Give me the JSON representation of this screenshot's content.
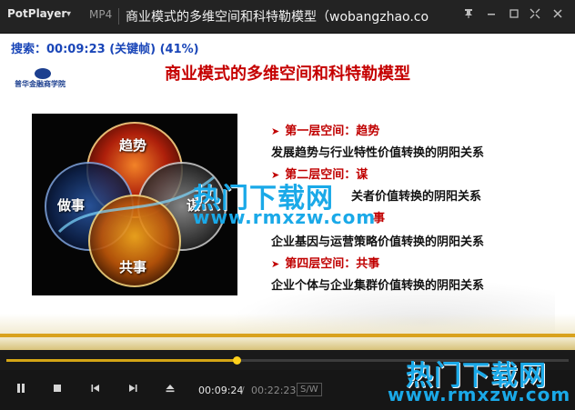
{
  "titlebar": {
    "app_name": "PotPlayer",
    "format": "MP4",
    "title": "商业模式的多维空间和科特勒模型（wobangzhao.co",
    "icons": [
      "chevron-down-icon",
      "pin-icon",
      "minimize-icon",
      "maximize-icon",
      "fullscreen-icon",
      "close-icon"
    ]
  },
  "video": {
    "search_overlay": "搜索：00:09:23 (关键帧) (41%)",
    "school_name": "普华金融商学院",
    "slide_title": "商业模式的多维空间和科特勒模型",
    "diagram_labels": {
      "top": "趋势",
      "left": "做事",
      "right": "谋",
      "bottom": "共事"
    },
    "bullets": [
      {
        "head": "第一层空间：趋势",
        "desc": "发展趋势与行业特性价值转换的阴阳关系"
      },
      {
        "head": "第二层空间：谋",
        "desc": "关者价值转换的阴阳关系"
      },
      {
        "head": "事",
        "desc": "企业基因与运营策略价值转换的阴阳关系"
      },
      {
        "head": "第四层空间：共事",
        "desc": "企业个体与企业集群价值转换的阴阳关系"
      }
    ],
    "watermarks": [
      {
        "cn": "热门下载网",
        "url": "www.rmxzw.com"
      },
      {
        "cn": "热门下载网",
        "url": "www.rmxzw.com"
      }
    ],
    "colors": {
      "accent_red": "#c50000",
      "overlay_blue": "#1a46b8",
      "watermark_blue": "#1aa9e8"
    }
  },
  "seek": {
    "progress": 0.41
  },
  "controls": {
    "time_current": "00:09:24",
    "time_separator": "/",
    "time_total": "00:22:23",
    "speed_badge": "S/W",
    "icons": [
      "pause-icon",
      "stop-icon",
      "previous-icon",
      "next-icon",
      "eject-icon"
    ],
    "accent": "#ffd11c"
  }
}
